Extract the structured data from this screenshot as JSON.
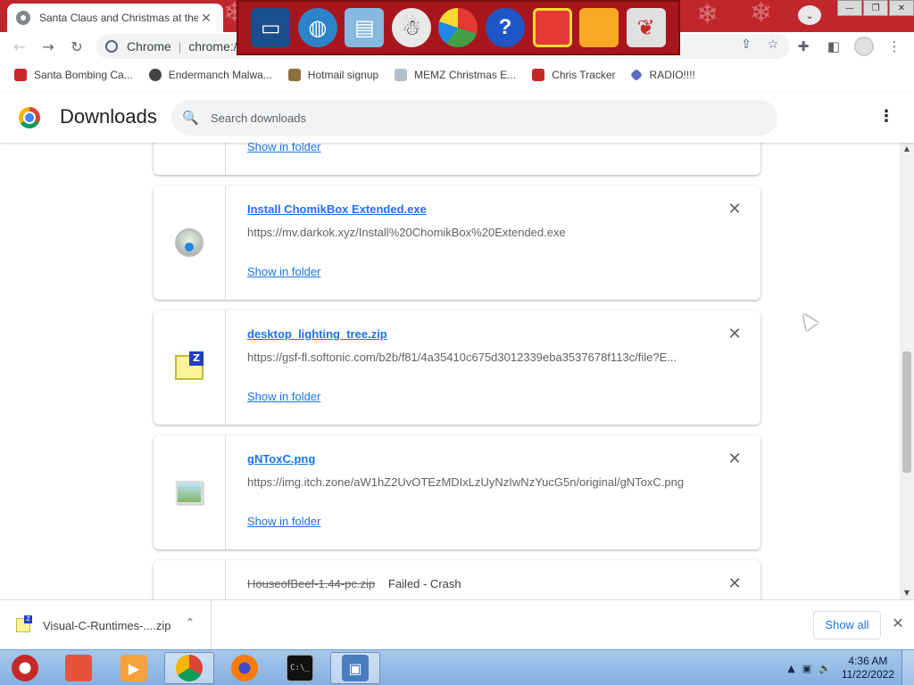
{
  "tab": {
    "title": "Santa Claus and Christmas at the",
    "close": "✕"
  },
  "window_controls": {
    "minimize": "—",
    "restore": "❐",
    "close": "✕"
  },
  "tab_search": "⌄",
  "toolbar": {
    "back": "←",
    "forward": "→",
    "reload": "↻",
    "omnibox_chip": "Chrome",
    "omnibox_url": "chrome://downloads",
    "share": "⇪",
    "star": "☆",
    "extensions": "✚",
    "sidepanel": "◧",
    "menu": "⋮"
  },
  "bookmarks": [
    {
      "label": "Santa Bombing Ca...",
      "icon": "santa-icon"
    },
    {
      "label": "Endermanch Malwa...",
      "icon": "creeper-icon"
    },
    {
      "label": "Hotmail signup",
      "icon": "figure-icon"
    },
    {
      "label": "MEMZ Christmas E...",
      "icon": "tree-icon"
    },
    {
      "label": "Chris Tracker",
      "icon": "chris-icon"
    },
    {
      "label": "RADIO!!!!",
      "icon": "radio-icon"
    }
  ],
  "downloads_page": {
    "title": "Downloads",
    "search_placeholder": "Search downloads",
    "search_icon": "🔍",
    "menu": "⋮",
    "items": [
      {
        "filename": "",
        "url": "",
        "show_in_folder": "Show in folder",
        "remove": "✕",
        "icon": "partial"
      },
      {
        "filename": "Install ChomikBox Extended.exe",
        "url": "https://mv.darkok.xyz/Install%20ChomikBox%20Extended.exe",
        "show_in_folder": "Show in folder",
        "remove": "✕",
        "icon": "exe-icon"
      },
      {
        "filename": "desktop_lighting_tree.zip",
        "url": "https://gsf-fl.softonic.com/b2b/f81/4a35410c675d3012339eba3537678f113c/file?E...",
        "show_in_folder": "Show in folder",
        "remove": "✕",
        "icon": "zip-icon"
      },
      {
        "filename": "gNToxC.png",
        "url": "https://img.itch.zone/aW1hZ2UvOTEzMDIxLzUyNzIwNzYucG5n/original/gNToxC.png",
        "show_in_folder": "Show in folder",
        "remove": "✕",
        "icon": "png-icon"
      },
      {
        "filename": "HouseofBeef-1.44-pc.zip",
        "status": "Failed - Crash",
        "remove": "✕",
        "icon": "failed"
      }
    ]
  },
  "scrollbar": {
    "up": "▲",
    "down": "▼"
  },
  "shelf": {
    "item_name": "Visual-C-Runtimes-....zip",
    "item_chevron": "⌃",
    "show_all": "Show all",
    "close": "✕"
  },
  "taskbar": {
    "apps": [
      "start-santa",
      "file-explorer",
      "media-player",
      "chrome",
      "firefox",
      "command-prompt",
      "program"
    ],
    "cmd_label": "C:\\_",
    "tray_arrow": "▲",
    "tray_network": "▣",
    "tray_volume": "🔊",
    "time": "4:36 AM",
    "date": "11/22/2022"
  },
  "colors": {
    "accent": "#1a73e8",
    "tabstrip": "#c0262c",
    "taskbar": "#a5c8ec"
  }
}
